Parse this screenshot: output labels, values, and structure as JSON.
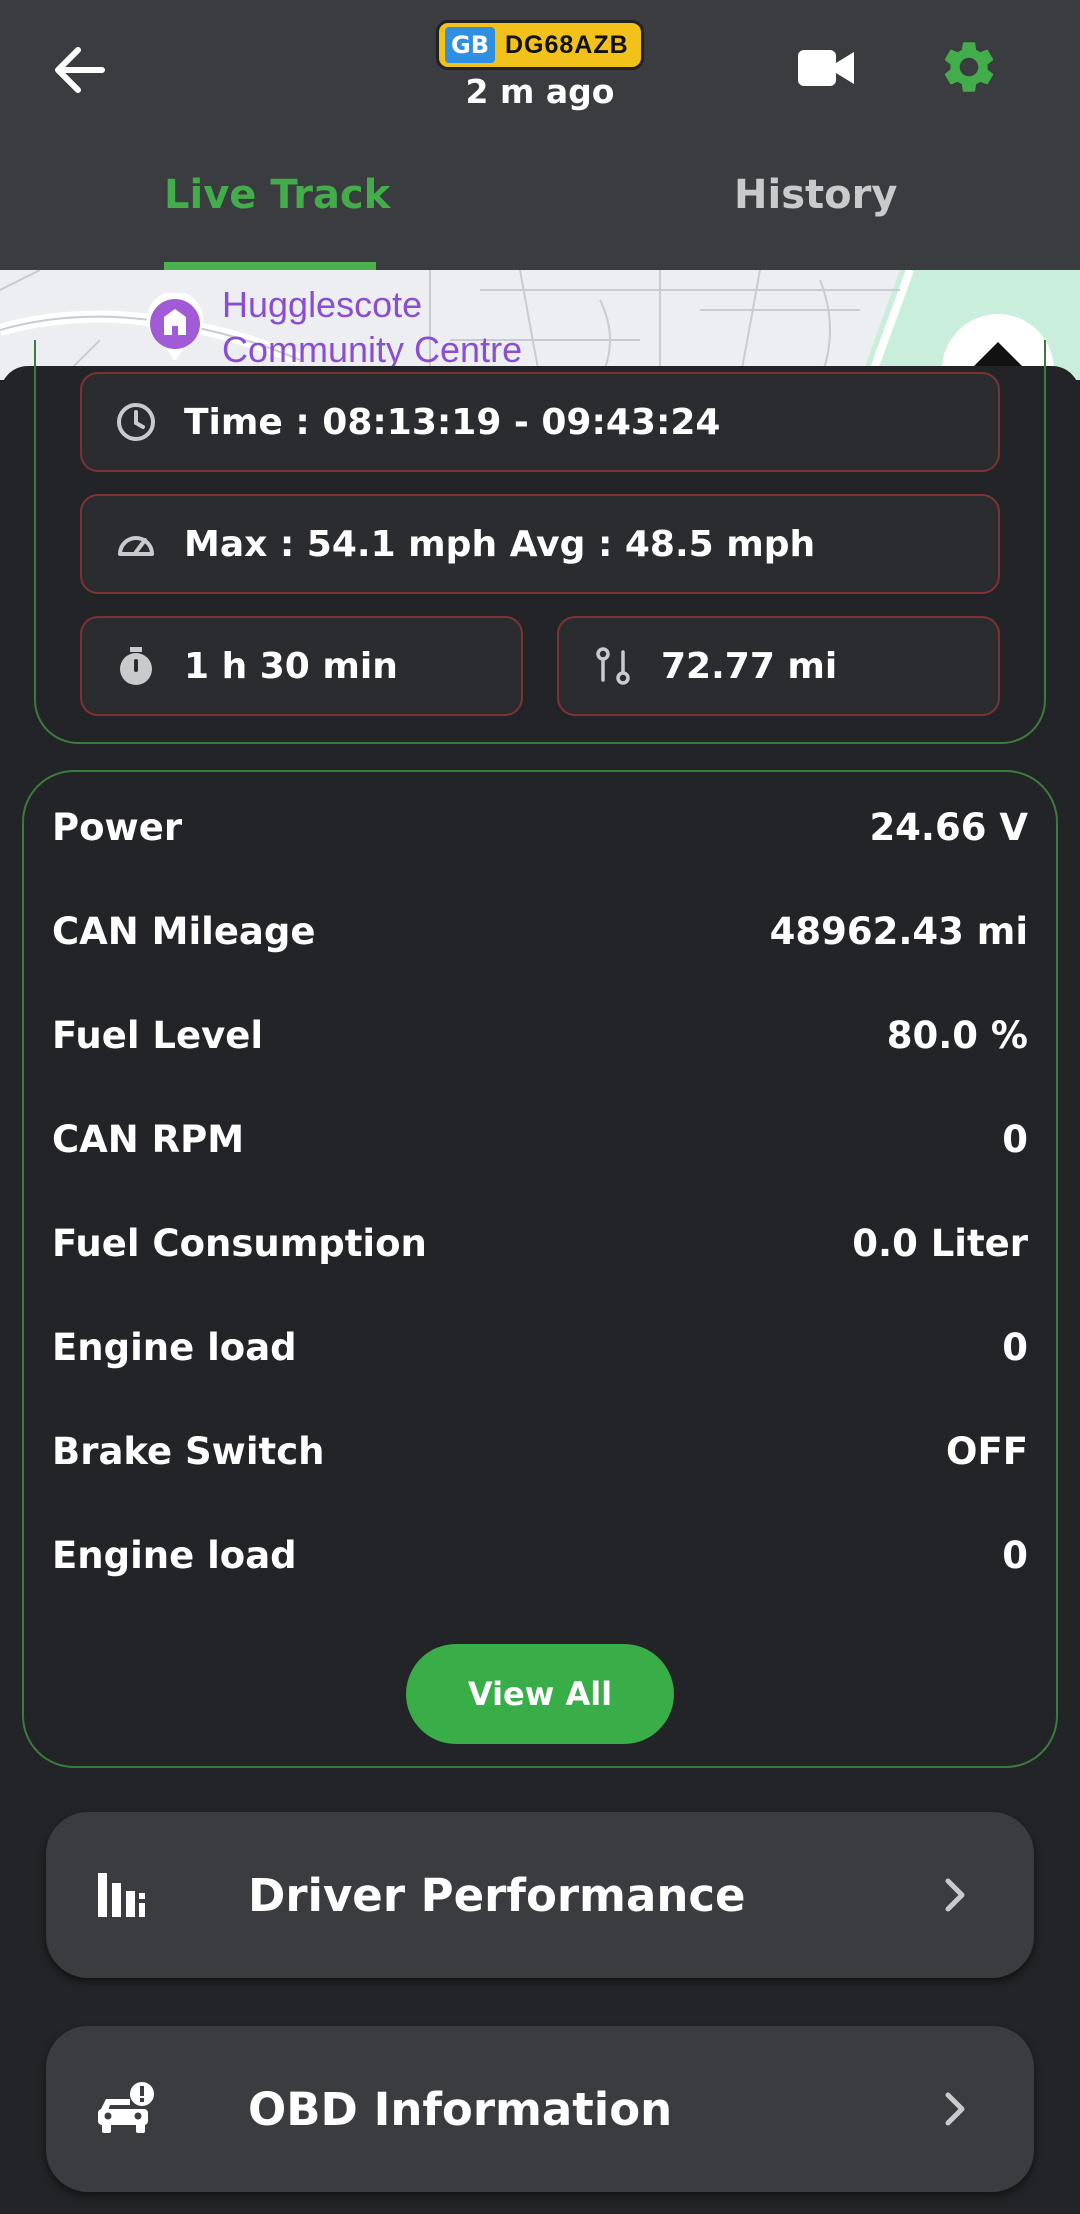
{
  "header": {
    "plate_country": "GB",
    "plate_number": "DG68AZB",
    "last_update": "2 m ago"
  },
  "tabs": [
    {
      "label": "Live Track",
      "active": true
    },
    {
      "label": "History",
      "active": false
    }
  ],
  "map": {
    "poi_line1": "Hugglescote",
    "poi_line2": "Community Centre"
  },
  "trip": {
    "time": "Time : 08:13:19 - 09:43:24",
    "speed": "Max : 54.1 mph  Avg : 48.5 mph",
    "duration": "1 h 30 min",
    "distance": "72.77 mi"
  },
  "stats": [
    {
      "label": "Power",
      "value": "24.66 V"
    },
    {
      "label": "CAN Mileage",
      "value": "48962.43 mi"
    },
    {
      "label": "Fuel Level",
      "value": "80.0 %"
    },
    {
      "label": "CAN RPM",
      "value": "0"
    },
    {
      "label": "Fuel Consumption",
      "value": "0.0 Liter"
    },
    {
      "label": "Engine load",
      "value": "0"
    },
    {
      "label": "Brake Switch",
      "value": "OFF"
    },
    {
      "label": "Engine load",
      "value": "0"
    }
  ],
  "view_all_label": "View All",
  "nav": [
    {
      "label": "Driver Performance",
      "icon": "bar-chart-icon"
    },
    {
      "label": "OBD Information",
      "icon": "car-alert-icon"
    }
  ],
  "colors": {
    "accent": "#43ac4b",
    "background": "#232427",
    "header": "#3a3c3f",
    "pill_border": "#7d3335",
    "card_border": "#3d7a3f"
  }
}
